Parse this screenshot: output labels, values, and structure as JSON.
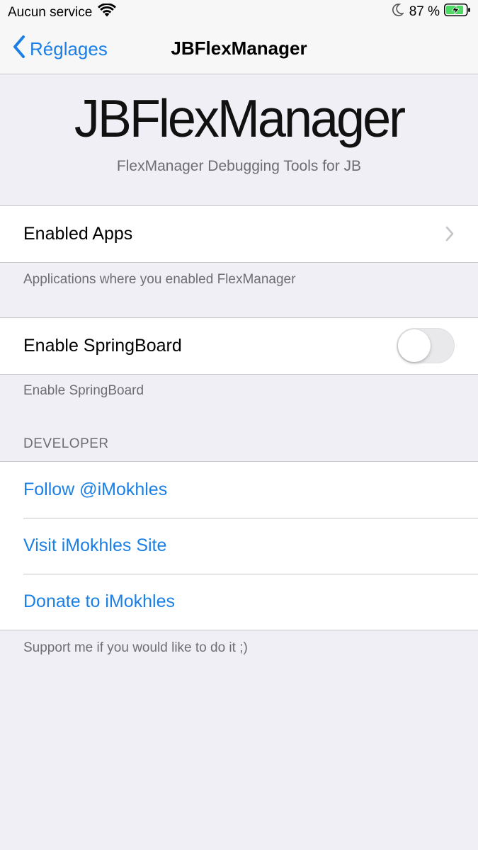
{
  "status_bar": {
    "carrier": "Aucun service",
    "battery_percent": "87 %",
    "icons": [
      "wifi-icon",
      "moon-icon",
      "battery-charging-icon"
    ]
  },
  "nav": {
    "back_label": "Réglages",
    "title": "JBFlexManager"
  },
  "header": {
    "title": "JBFlexManager",
    "subtitle": "FlexManager Debugging Tools for JB"
  },
  "sections": {
    "apps": {
      "item_label": "Enabled Apps",
      "footer": "Applications where you enabled FlexManager"
    },
    "springboard": {
      "item_label": "Enable SpringBoard",
      "toggle_on": false,
      "footer": "Enable SpringBoard"
    },
    "developer": {
      "header": "DEVELOPER",
      "items": [
        {
          "label": "Follow @iMokhles"
        },
        {
          "label": "Visit iMokhles Site"
        },
        {
          "label": "Donate to iMokhles"
        }
      ],
      "footer": "Support me if you would like to do it ;)"
    }
  },
  "colors": {
    "accent": "#1a7fe6",
    "background": "#f0eff5",
    "secondary_text": "#6d6d72",
    "battery_green": "#4cd964"
  }
}
